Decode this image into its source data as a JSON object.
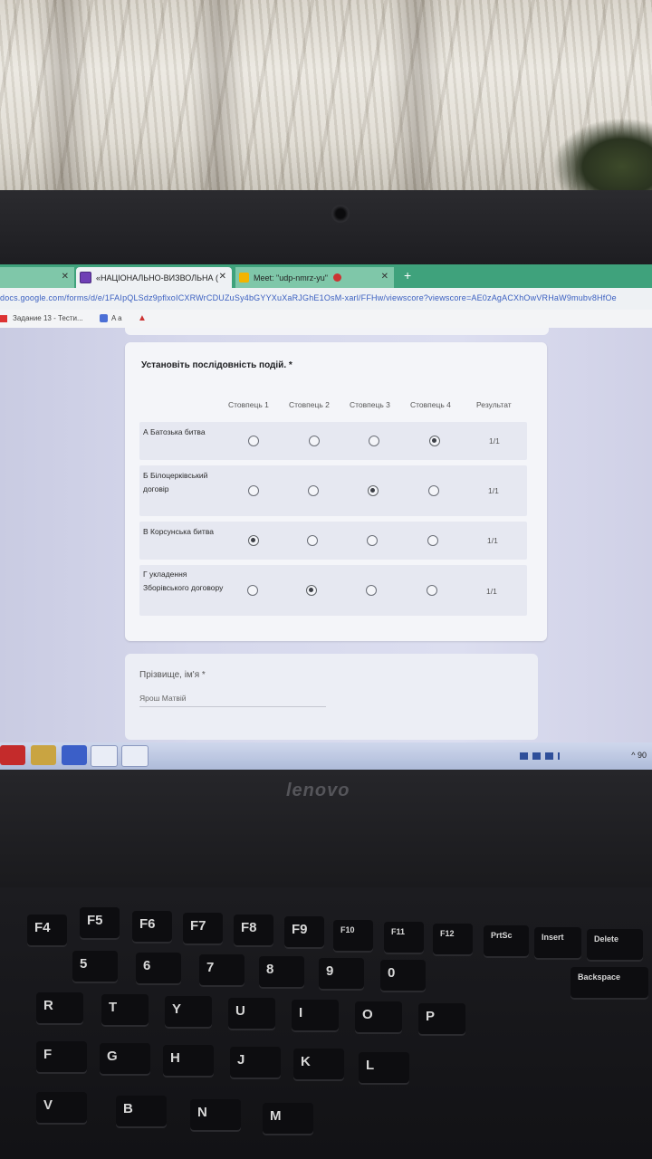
{
  "browser": {
    "tabs": [
      {
        "label": ""
      },
      {
        "label": "«НАЦІОНАЛЬНО-ВИЗВОЛЬНА ("
      },
      {
        "label": "Meet: \"udp-nmrz-yu\""
      }
    ],
    "new_tab": "+",
    "url": "docs.google.com/forms/d/e/1FAIpQLSdz9pflxoICXRWrCDUZuSy4bGYYXuXaRJGhE1OsM-xarl/FFHw/viewscore?viewscore=AE0zAgACXhOwVRHaW9mubv8HfOe",
    "bookmarks": [
      {
        "label": "Задание 13 - Тести..."
      },
      {
        "label": "A a"
      }
    ]
  },
  "form": {
    "question_title": "Установіть послідовність подій. *",
    "columns": [
      "Стовпець 1",
      "Стовпець 2",
      "Стовпець 3",
      "Стовпець 4",
      "Результат"
    ],
    "rows": [
      {
        "label": "А Батозька битва",
        "selected": 4,
        "result": "1/1"
      },
      {
        "label": "Б Білоцерківський договір",
        "selected": 3,
        "result": "1/1"
      },
      {
        "label": "В Корсунська битва",
        "selected": 1,
        "result": "1/1"
      },
      {
        "label": "Г укладення Зборівського договору",
        "selected": 2,
        "result": "1/1"
      }
    ],
    "name_question": "Прізвище, ім'я *",
    "name_answer": "Ярош Матвій"
  },
  "taskbar": {
    "tray_text": "^ 90"
  },
  "laptop": {
    "brand": "lenovo"
  },
  "keyboard": {
    "keys": [
      "F4",
      "F5",
      "F6",
      "F7",
      "F8",
      "F9",
      "F10",
      "F11",
      "F12",
      "PrtSc",
      "Insert",
      "Delete",
      "5",
      "6",
      "7",
      "8",
      "9",
      "0",
      "Backspace",
      "R",
      "T",
      "Y",
      "U",
      "I",
      "O",
      "P",
      "F",
      "G",
      "H",
      "J",
      "K",
      "L",
      "V",
      "B",
      "N",
      "M"
    ]
  }
}
